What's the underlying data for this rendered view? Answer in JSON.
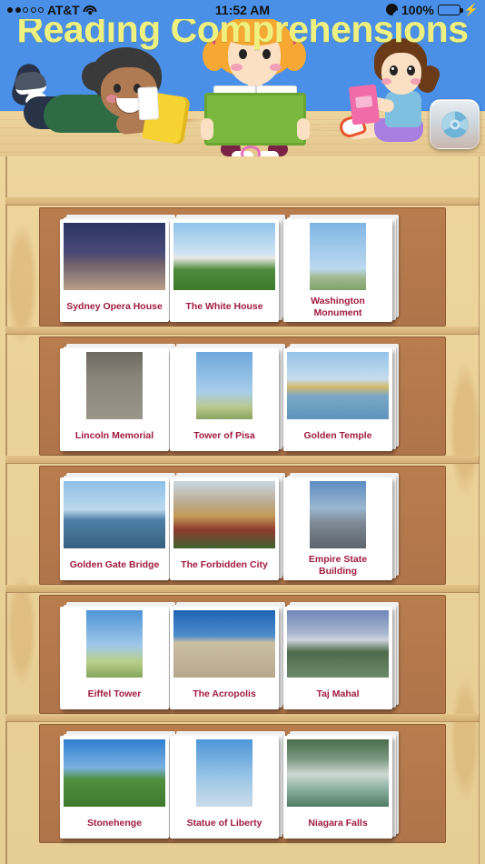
{
  "status_bar": {
    "carrier": "AT&T",
    "time": "11:52 AM",
    "battery_percent": "100%",
    "signal_filled": 2,
    "signal_total": 5,
    "wifi_icon": "wifi-icon",
    "alarm_icon": "alarm-clock-icon",
    "battery_icon": "battery-icon",
    "charging_icon": "lightning-bolt-icon"
  },
  "header": {
    "title": "Reading Comprehensions",
    "title_color": "#eef07f",
    "background_color": "#4a90e8",
    "refresh_button_label": "refresh-icon"
  },
  "theme": {
    "shelf_color": "#b5794a",
    "wood_background": "#e6cd95",
    "card_label_color": "#a01b3f",
    "card_background": "#ffffff"
  },
  "shelves": [
    {
      "row": 1,
      "cards": [
        {
          "title": "Sydney Opera House",
          "image": "sydney-opera-house",
          "pic_class": "p-sydney",
          "narrow": false
        },
        {
          "title": "The White House",
          "image": "the-white-house",
          "pic_class": "p-wh",
          "narrow": false
        },
        {
          "title": "Washington Monument",
          "image": "washington-monument",
          "pic_class": "p-wm",
          "narrow": true
        }
      ]
    },
    {
      "row": 2,
      "cards": [
        {
          "title": "Lincoln Memorial",
          "image": "lincoln-memorial",
          "pic_class": "p-lm",
          "narrow": true
        },
        {
          "title": "Tower of Pisa",
          "image": "tower-of-pisa",
          "pic_class": "p-pisa",
          "narrow": true
        },
        {
          "title": "Golden Temple",
          "image": "golden-temple",
          "pic_class": "p-gt",
          "narrow": false
        }
      ]
    },
    {
      "row": 3,
      "cards": [
        {
          "title": "Golden Gate Bridge",
          "image": "golden-gate-bridge",
          "pic_class": "p-ggb",
          "narrow": false
        },
        {
          "title": "The Forbidden City",
          "image": "the-forbidden-city",
          "pic_class": "p-fc",
          "narrow": false
        },
        {
          "title": "Empire State Building",
          "image": "empire-state-building",
          "pic_class": "p-es",
          "narrow": true
        }
      ]
    },
    {
      "row": 4,
      "cards": [
        {
          "title": "Eiffel Tower",
          "image": "eiffel-tower",
          "pic_class": "p-et",
          "narrow": true
        },
        {
          "title": "The Acropolis",
          "image": "the-acropolis",
          "pic_class": "p-ac",
          "narrow": false
        },
        {
          "title": "Taj Mahal",
          "image": "taj-mahal",
          "pic_class": "p-tm",
          "narrow": false
        }
      ]
    },
    {
      "row": 5,
      "cards": [
        {
          "title": "Stonehenge",
          "image": "stonehenge",
          "pic_class": "p-sh",
          "narrow": false
        },
        {
          "title": "Statue of Liberty",
          "image": "statue-of-liberty",
          "pic_class": "p-sl",
          "narrow": true
        },
        {
          "title": "Niagara Falls",
          "image": "niagara-falls",
          "pic_class": "p-nf",
          "narrow": false
        }
      ]
    }
  ]
}
